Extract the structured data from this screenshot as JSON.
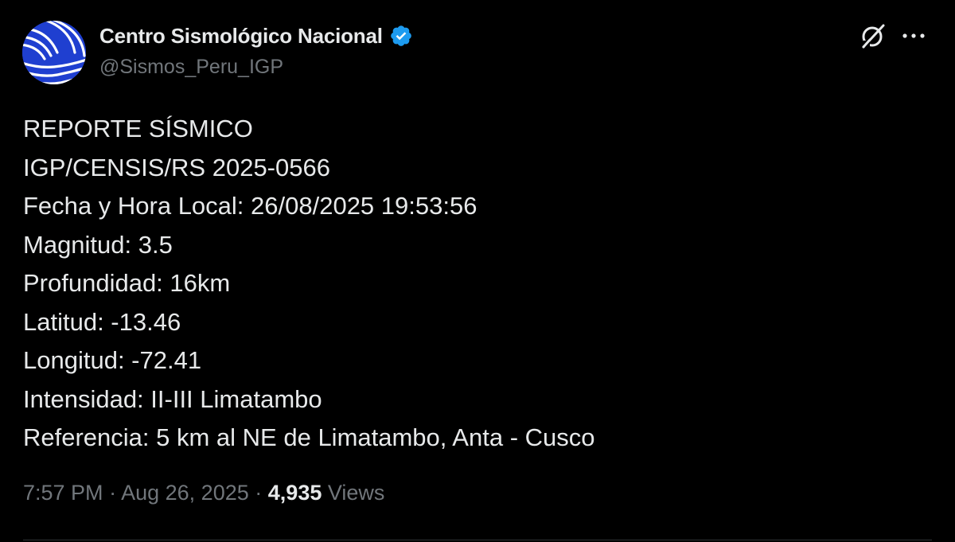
{
  "author": {
    "display_name": "Centro Sismológico Nacional",
    "handle": "@Sismos_Peru_IGP",
    "verified": true,
    "avatar_colors": {
      "background": "#1f3fd0",
      "stripes": "#ffffff"
    }
  },
  "header_icons": {
    "grok": "grok-icon",
    "more": "more-options-icon"
  },
  "post": {
    "lines": [
      "REPORTE SÍSMICO",
      "IGP/CENSIS/RS 2025-0566",
      "Fecha y Hora Local: 26/08/2025 19:53:56",
      "Magnitud: 3.5",
      "Profundidad: 16km",
      "Latitud: -13.46",
      "Longitud: -72.41",
      "Intensidad: II-III Limatambo",
      "Referencia: 5 km al NE de Limatambo, Anta - Cusco"
    ]
  },
  "meta": {
    "time": "7:57 PM",
    "separator": "·",
    "date": "Aug 26, 2025",
    "views_count": "4,935",
    "views_label": "Views"
  },
  "colors": {
    "background": "#000000",
    "text_primary": "#e7e9ea",
    "text_secondary": "#71767b",
    "verified_badge": "#1d9bf0",
    "divider": "#2f3336"
  }
}
